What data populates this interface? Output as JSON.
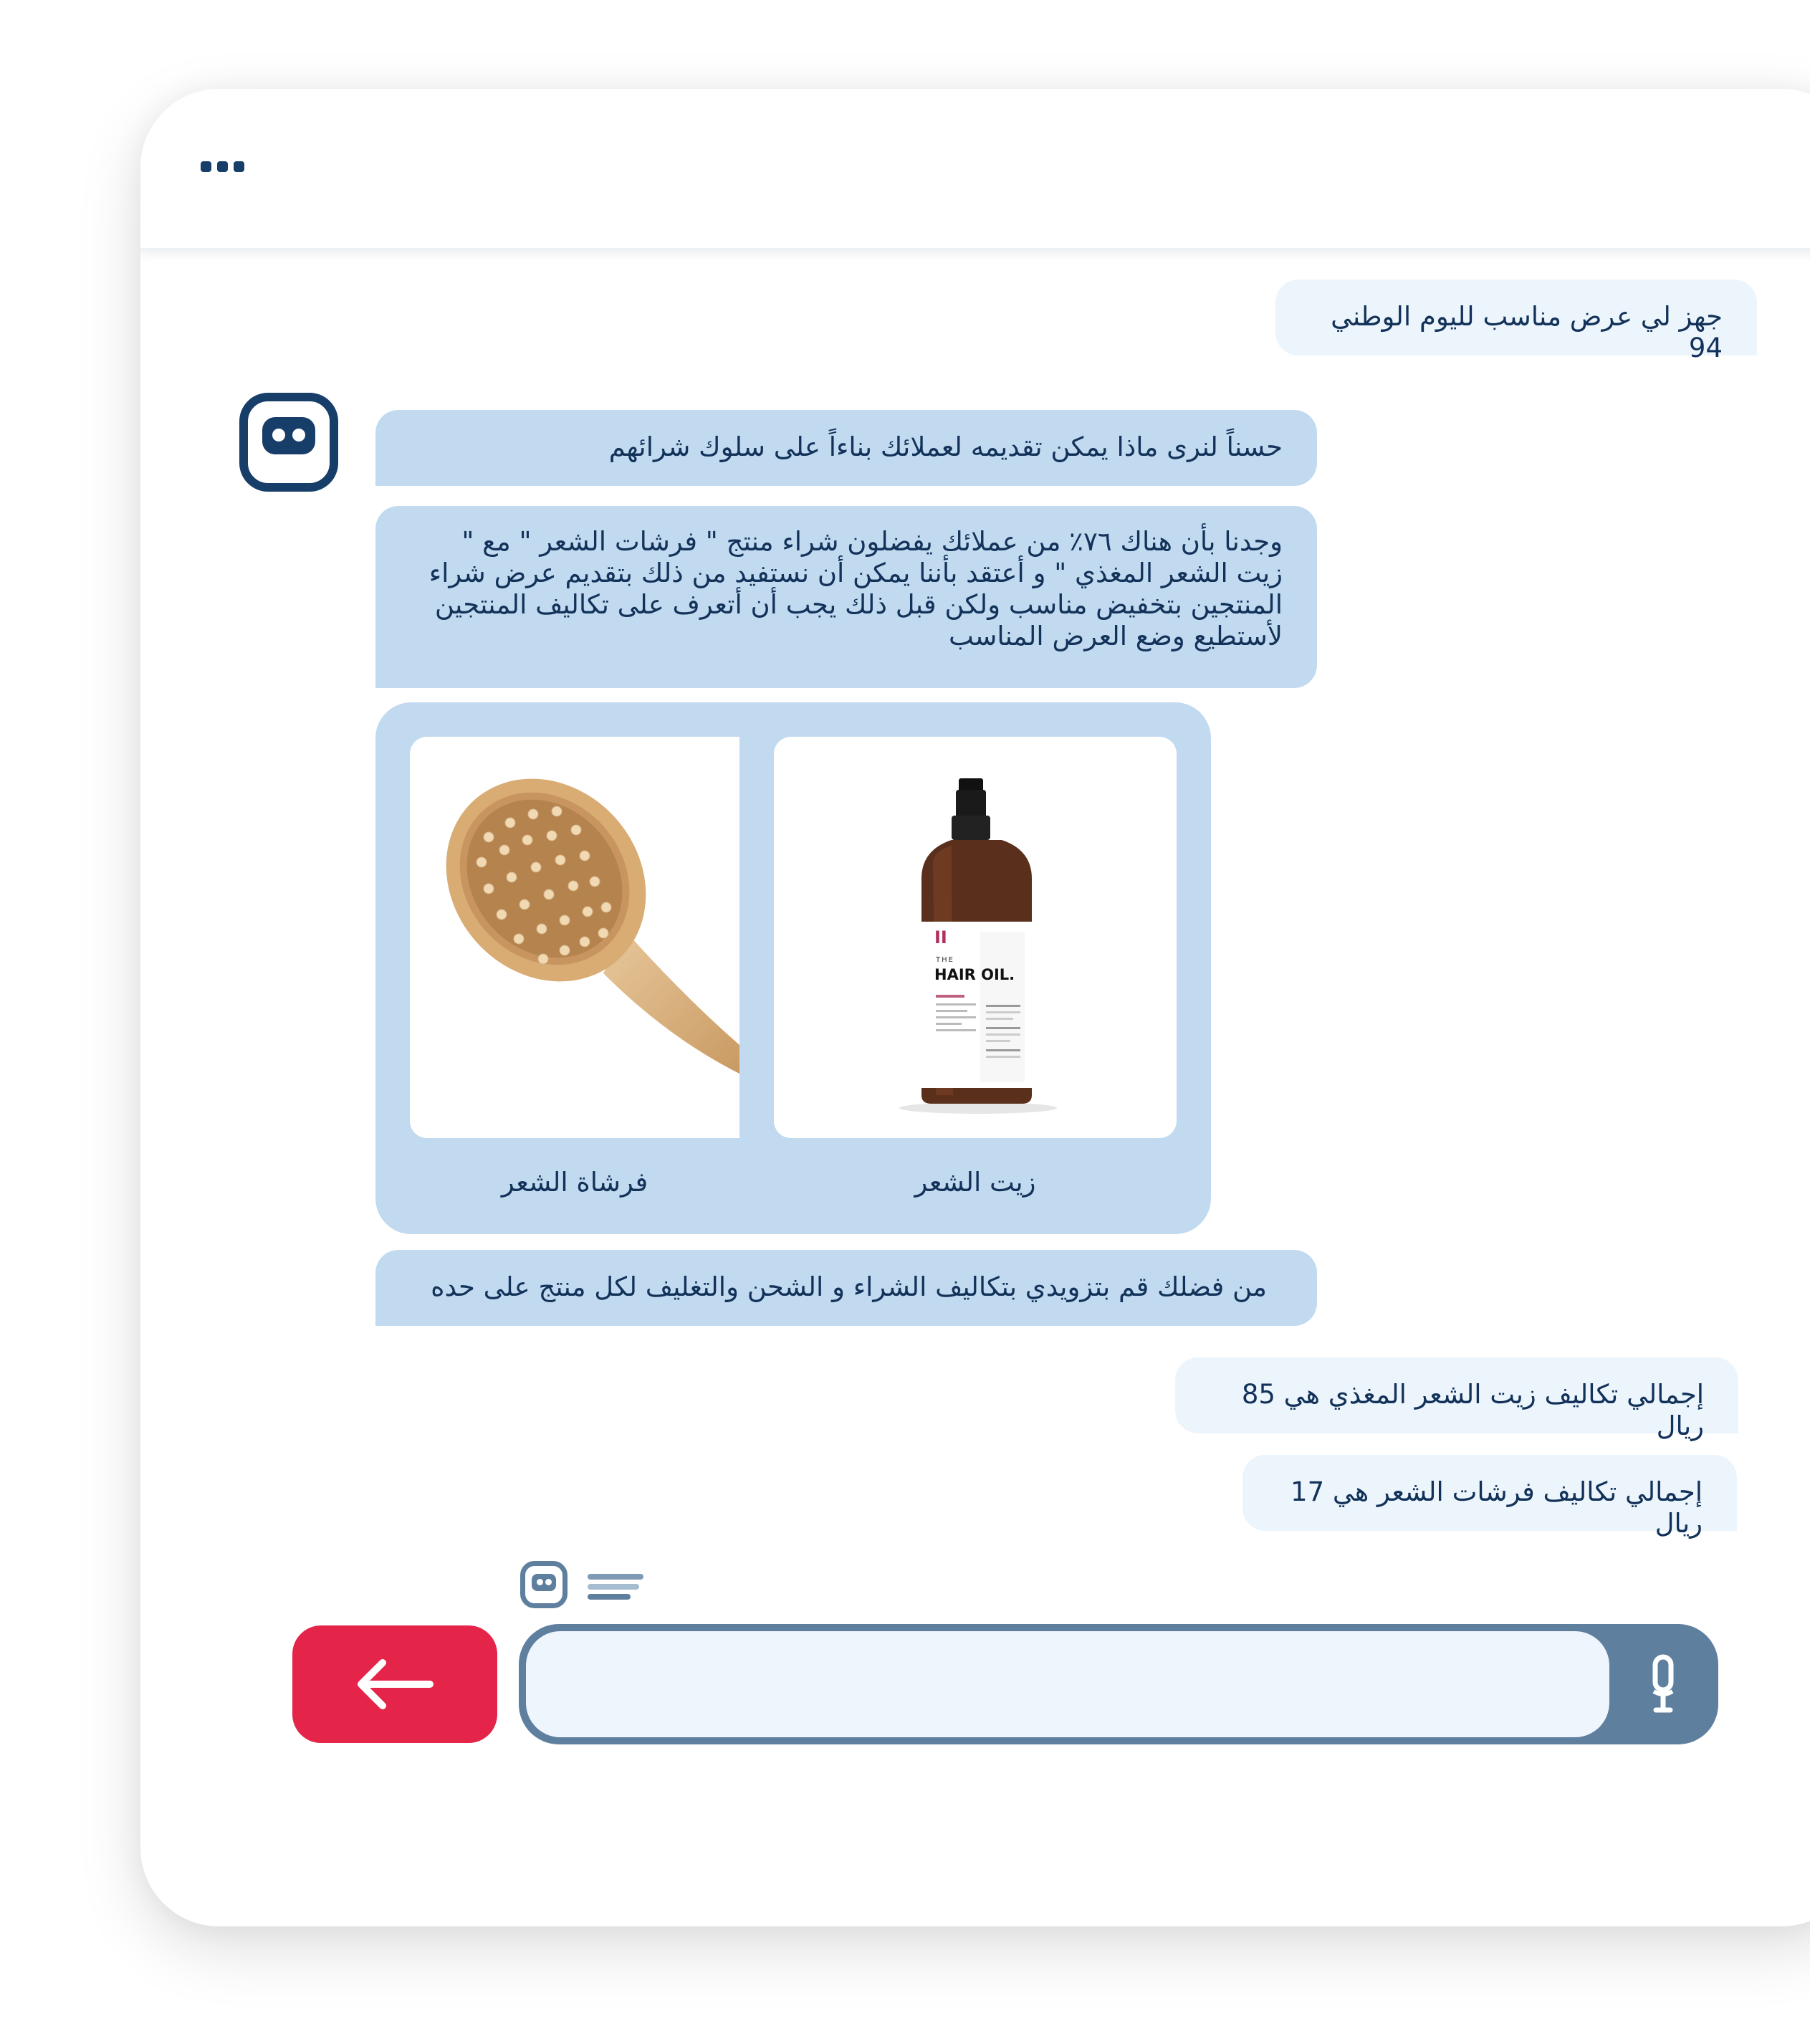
{
  "window": {
    "menu_icon": "more-dots-icon"
  },
  "messages": {
    "user_1": "جهز لي عرض مناسب لليوم الوطني 94",
    "bot_1": "حسناً لنرى ماذا يمكن تقديمه لعملائك بناءاً على سلوك شرائهم",
    "bot_2": "وجدنا بأن هناك ٧٦٪ من عملائك يفضلون شراء منتج \" فرشات الشعر \" مع \" زيت الشعر المغذي \" و أعتقد بأننا يمكن أن نستفيد من ذلك بتقديم عرض شراء المنتجين بتخفيض مناسب ولكن قبل ذلك يجب أن أتعرف على تكاليف المنتجين لأستطيع وضع العرض المناسب",
    "bot_3": "من فضلك قم بتزويدي بتكاليف الشراء و الشحن والتغليف لكل منتج على حده",
    "user_2": "إجمالي تكاليف زيت الشعر المغذي هي 85 ريال",
    "user_3": "إجمالي تكاليف فرشات الشعر هي 17 ريال"
  },
  "products": {
    "hair_oil": {
      "caption": "زيت الشعر",
      "brand_mark": "II",
      "label_the": "THE",
      "label_title": "HAIR OIL."
    },
    "hair_brush": {
      "caption": "فرشاة الشعر"
    }
  },
  "composer": {
    "input_value": "",
    "send_icon": "arrow-left-icon",
    "mic_icon": "microphone-icon"
  },
  "colors": {
    "accent_red": "#e5244a",
    "navy": "#173d69",
    "bot_bubble": "#c2daf0",
    "user_bubble": "#edf5fc",
    "input_frame": "#5f7f9f"
  }
}
